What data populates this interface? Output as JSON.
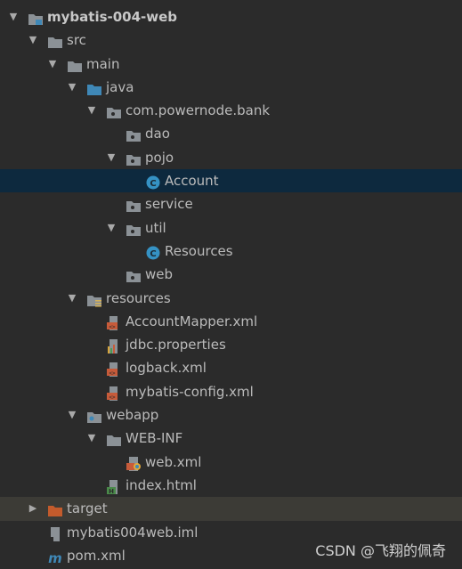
{
  "project_tree": {
    "items": [
      {
        "label": "mybatis-004-web",
        "depth": 0,
        "arrow": "down",
        "icon": "module-folder-icon",
        "bold": true
      },
      {
        "label": "src",
        "depth": 1,
        "arrow": "down",
        "icon": "folder-icon"
      },
      {
        "label": "main",
        "depth": 2,
        "arrow": "down",
        "icon": "folder-icon"
      },
      {
        "label": "java",
        "depth": 3,
        "arrow": "down",
        "icon": "source-root-folder-icon"
      },
      {
        "label": "com.powernode.bank",
        "depth": 4,
        "arrow": "down",
        "icon": "package-icon"
      },
      {
        "label": "dao",
        "depth": 5,
        "arrow": "none",
        "icon": "package-icon"
      },
      {
        "label": "pojo",
        "depth": 5,
        "arrow": "down",
        "icon": "package-icon"
      },
      {
        "label": "Account",
        "depth": 6,
        "arrow": "none",
        "icon": "class-icon",
        "selected": true
      },
      {
        "label": "service",
        "depth": 5,
        "arrow": "none",
        "icon": "package-icon"
      },
      {
        "label": "util",
        "depth": 5,
        "arrow": "down",
        "icon": "package-icon"
      },
      {
        "label": "Resources",
        "depth": 6,
        "arrow": "none",
        "icon": "class-icon"
      },
      {
        "label": "web",
        "depth": 5,
        "arrow": "none",
        "icon": "package-icon"
      },
      {
        "label": "resources",
        "depth": 3,
        "arrow": "down",
        "icon": "resources-root-folder-icon"
      },
      {
        "label": "AccountMapper.xml",
        "depth": 4,
        "arrow": "none",
        "icon": "xml-file-icon"
      },
      {
        "label": "jdbc.properties",
        "depth": 4,
        "arrow": "none",
        "icon": "properties-file-icon"
      },
      {
        "label": "logback.xml",
        "depth": 4,
        "arrow": "none",
        "icon": "xml-file-icon"
      },
      {
        "label": "mybatis-config.xml",
        "depth": 4,
        "arrow": "none",
        "icon": "xml-file-icon"
      },
      {
        "label": "webapp",
        "depth": 3,
        "arrow": "down",
        "icon": "web-folder-icon"
      },
      {
        "label": "WEB-INF",
        "depth": 4,
        "arrow": "down",
        "icon": "folder-icon"
      },
      {
        "label": "web.xml",
        "depth": 5,
        "arrow": "none",
        "icon": "web-xml-file-icon"
      },
      {
        "label": "index.html",
        "depth": 4,
        "arrow": "none",
        "icon": "html-file-icon"
      },
      {
        "label": "target",
        "depth": 1,
        "arrow": "right",
        "icon": "excluded-folder-icon",
        "excluded": true
      },
      {
        "label": "mybatis004web.iml",
        "depth": 1,
        "arrow": "none",
        "icon": "iml-file-icon"
      },
      {
        "label": "pom.xml",
        "depth": 1,
        "arrow": "none",
        "icon": "maven-file-icon"
      }
    ]
  },
  "watermark": "CSDN @飞翔的佩奇",
  "colors": {
    "background": "#2b2b2b",
    "selected_row": "#0d293e",
    "excluded_row": "#3c3b36",
    "folder": "#8b9196",
    "source_root": "#3f88b7",
    "class_icon": "#3592c4",
    "xml_icon": "#c75b3a",
    "excluded_folder": "#c35b2c"
  }
}
